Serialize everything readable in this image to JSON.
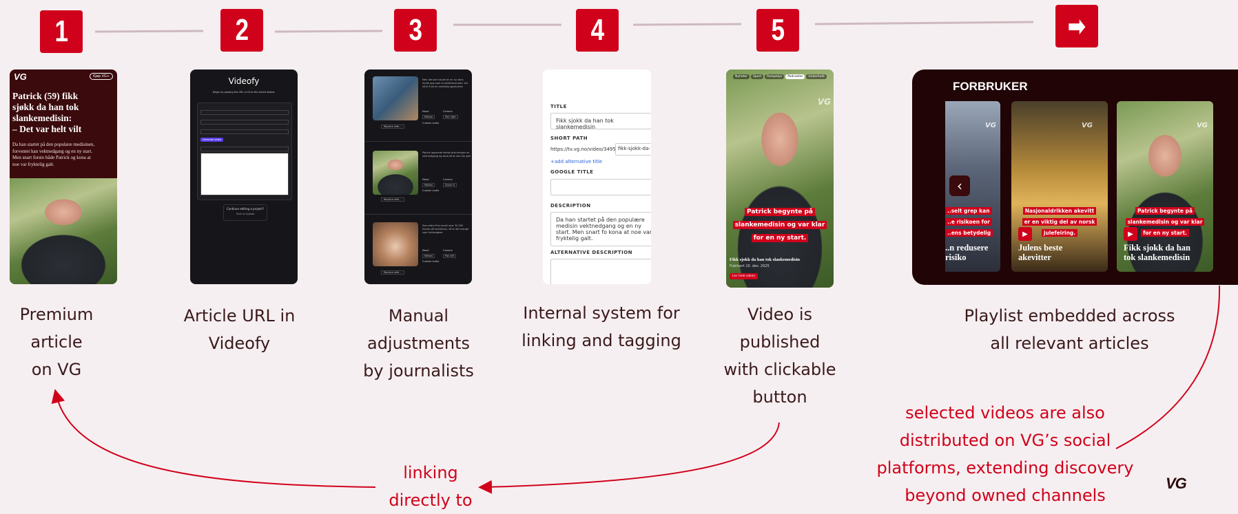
{
  "steps": [
    {
      "number": "1",
      "caption_lines": [
        "Premium",
        "article",
        "on VG"
      ]
    },
    {
      "number": "2",
      "caption_lines": [
        "Article URL in",
        "Videofy"
      ]
    },
    {
      "number": "3",
      "caption_lines": [
        "Manual",
        "adjustments",
        "by journalists"
      ]
    },
    {
      "number": "4",
      "caption_lines": [
        "Internal system for",
        "linking and tagging"
      ]
    },
    {
      "number": "5",
      "caption_lines": [
        "Video is",
        "published",
        "with clickable",
        "button"
      ]
    },
    {
      "number": "➡",
      "caption_lines": [
        "Playlist embedded across",
        "all relevant articles"
      ]
    }
  ],
  "annotations": {
    "linking_lines": [
      "linking",
      "directly to"
    ],
    "social_lines": [
      "selected videos are also",
      "distributed on VG’s social",
      "platforms, extending discovery",
      "beyond owned channels"
    ]
  },
  "article": {
    "logo": "VG",
    "badge": "Kjøp VG+",
    "headline_lines": [
      "Patrick (59) fikk",
      "sjøkk da han tok",
      "slankemedisin:",
      "– Det var helt vilt"
    ],
    "lede_lines": [
      "Da han startet på den populære medisinen,",
      "forventet han vektnedgang og en ny start.",
      "Men snart forsto både Patrick og kona at",
      "noe var fryktelig galt."
    ]
  },
  "videofy": {
    "title": "Videofy",
    "subtitle": "Begin by pasting the URL or ID to the article below.",
    "generate_button": "Generate video",
    "continue_text": "Continue editing a project?",
    "continue_button": "Click to Upload"
  },
  "editor": {
    "scene_texts": [
      "Men det som skulle bli en ny start, endte opp som et skrekkscenario. Var så til å bli en merkelig opplevelse",
      "Patrick opplevde sterke bivirkninger av vektnedgang og kona så at noe var galt",
      "Som eldre å ha brukt over 30 000 kroner på medisinen, så er det mange som fruktesjøner"
    ],
    "control_labels": [
      "Mood",
      "Camera",
      "Custom audio"
    ],
    "mood_value": "Mellow",
    "camera_values": [
      "Pan right",
      "Zoom in",
      "Pan left"
    ],
    "replace_label": "Replace with..."
  },
  "cms": {
    "title_label": "TITLE",
    "title_value": "Fikk sjokk da han tok slankemedisin",
    "short_path_label": "SHORT PATH",
    "short_path_prefix": "https://tv.vg.no/video/349578/",
    "short_path_value": "fikk-sjokk-da-",
    "add_alt_title": "+add alternative title",
    "google_title_label": "GOOGLE TITLE",
    "description_label": "DESCRIPTION",
    "description_value": "Da han startet på den populære medisin vektnedgang og en ny start. Men snart fo kona at noe var fryktelig galt.",
    "alt_description_label": "ALTERNATIVE DESCRIPTION"
  },
  "video": {
    "nav_items": [
      "Nyheter",
      "Sport",
      "Rampelys",
      "Podcaster",
      "Underhold"
    ],
    "active_nav": "Podcaster",
    "overlay_lines": [
      "Patrick begynte på",
      "slankemedisin og var klar",
      "for en ny start."
    ],
    "title": "Fikk sjokk da han tok slankemedisin",
    "published": "Publisert 10. des. 2025",
    "button": "Les hele saken"
  },
  "playlist": {
    "heading": "FORBRUKER",
    "cards": [
      {
        "overlay_lines": [
          "..selt grep kan",
          "..e risikoen for",
          "..ens betydelig"
        ],
        "title_lines": [
          "..n redusere",
          "risiko"
        ]
      },
      {
        "overlay_lines": [
          "Nasjonaldrikken akevitt",
          "er en viktig del av norsk",
          "julefeiring."
        ],
        "title_lines": [
          "Julens beste",
          "akevitter"
        ]
      },
      {
        "overlay_lines": [
          "Patrick begynte på",
          "slankemedisin og var klar",
          "for en ny start."
        ],
        "title_lines": [
          "Fikk sjokk da han",
          "tok slankemedisin"
        ]
      }
    ]
  },
  "footer_logo": "VG",
  "colors": {
    "accent": "#d0021b",
    "background": "#f6eff1",
    "text": "#3a1a1c",
    "connector": "#cdb9bd"
  }
}
